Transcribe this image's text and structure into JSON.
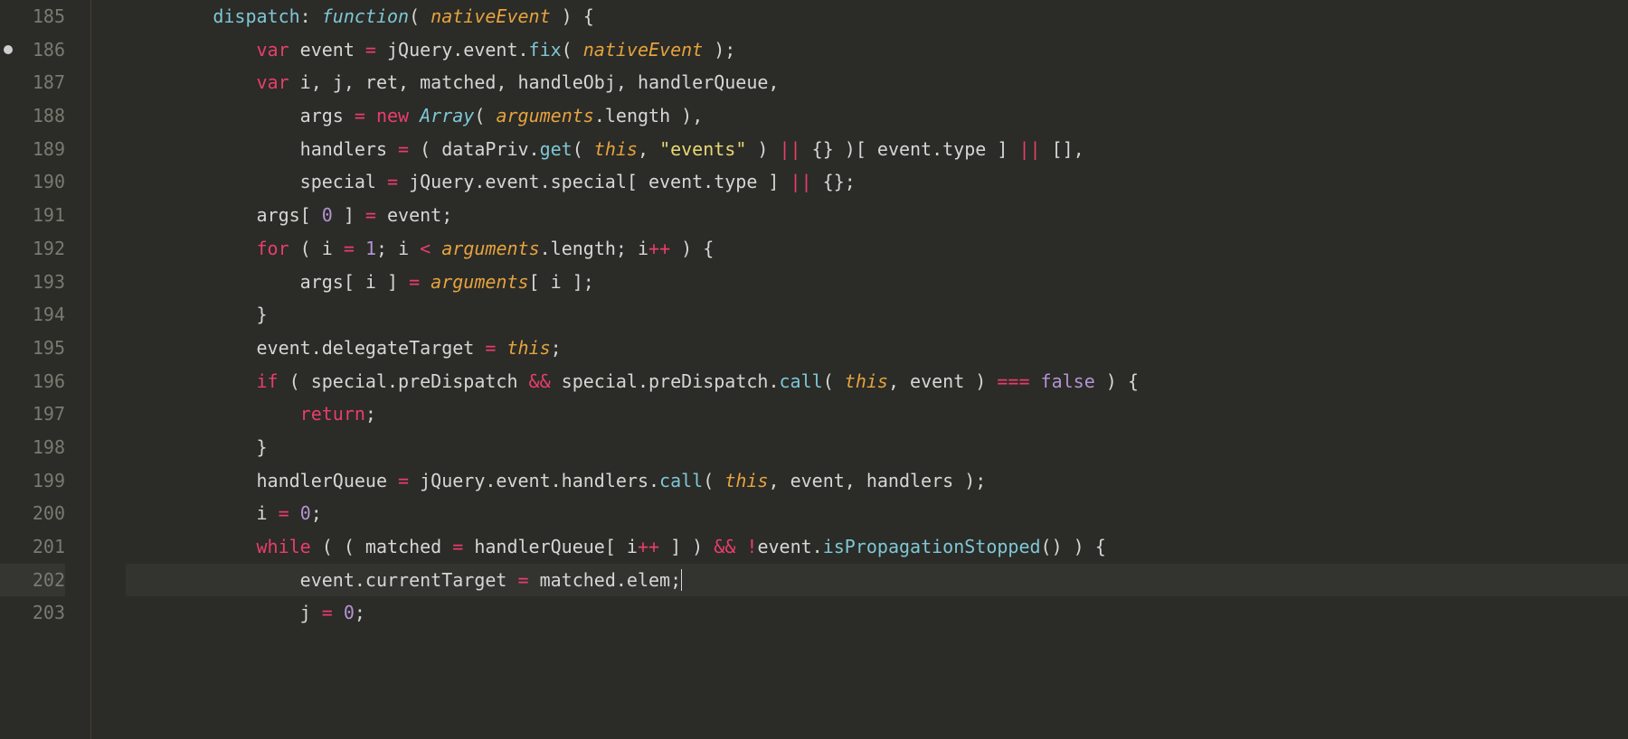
{
  "gutter": {
    "start": 185,
    "end": 203,
    "modified": [
      186
    ],
    "current": 202
  },
  "code": {
    "lines": [
      {
        "n": 185,
        "indent": 2,
        "tokens": [
          [
            "name",
            "dispatch"
          ],
          [
            "punct",
            ": "
          ],
          [
            "func",
            "function"
          ],
          [
            "punct",
            "( "
          ],
          [
            "this",
            "nativeEvent"
          ],
          [
            "punct",
            " ) {"
          ]
        ]
      },
      {
        "n": 186,
        "indent": 3,
        "tokens": [
          [
            "key",
            "var"
          ],
          [
            "ident",
            " event "
          ],
          [
            "op",
            "="
          ],
          [
            "ident",
            " jQuery.event."
          ],
          [
            "call",
            "fix"
          ],
          [
            "punct",
            "( "
          ],
          [
            "this",
            "nativeEvent"
          ],
          [
            "punct",
            " );"
          ]
        ]
      },
      {
        "n": 187,
        "indent": 3,
        "tokens": [
          [
            "key",
            "var"
          ],
          [
            "ident",
            " i, j, ret, matched, handleObj, handlerQueue,"
          ]
        ]
      },
      {
        "n": 188,
        "indent": 4,
        "tokens": [
          [
            "ident",
            "args "
          ],
          [
            "op",
            "="
          ],
          [
            "ident",
            " "
          ],
          [
            "key",
            "new"
          ],
          [
            "ident",
            " "
          ],
          [
            "func",
            "Array"
          ],
          [
            "punct",
            "( "
          ],
          [
            "this",
            "arguments"
          ],
          [
            "punct",
            ".length ),"
          ]
        ]
      },
      {
        "n": 189,
        "indent": 4,
        "tokens": [
          [
            "ident",
            "handlers "
          ],
          [
            "op",
            "="
          ],
          [
            "punct",
            " ( dataPriv."
          ],
          [
            "call",
            "get"
          ],
          [
            "punct",
            "( "
          ],
          [
            "this",
            "this"
          ],
          [
            "punct",
            ", "
          ],
          [
            "str",
            "\"events\""
          ],
          [
            "punct",
            " ) "
          ],
          [
            "op",
            "||"
          ],
          [
            "punct",
            " {} )[ event.type ] "
          ],
          [
            "op",
            "||"
          ],
          [
            "punct",
            " [],"
          ]
        ]
      },
      {
        "n": 190,
        "indent": 4,
        "tokens": [
          [
            "ident",
            "special "
          ],
          [
            "op",
            "="
          ],
          [
            "ident",
            " jQuery.event.special[ event.type ] "
          ],
          [
            "op",
            "||"
          ],
          [
            "punct",
            " {};"
          ]
        ]
      },
      {
        "n": 191,
        "indent": 3,
        "tokens": [
          [
            "ident",
            "args[ "
          ],
          [
            "num",
            "0"
          ],
          [
            "ident",
            " ] "
          ],
          [
            "op",
            "="
          ],
          [
            "ident",
            " event;"
          ]
        ]
      },
      {
        "n": 192,
        "indent": 3,
        "tokens": [
          [
            "key",
            "for"
          ],
          [
            "punct",
            " ( i "
          ],
          [
            "op",
            "="
          ],
          [
            "punct",
            " "
          ],
          [
            "num",
            "1"
          ],
          [
            "punct",
            "; i "
          ],
          [
            "op",
            "<"
          ],
          [
            "punct",
            " "
          ],
          [
            "this",
            "arguments"
          ],
          [
            "punct",
            ".length; i"
          ],
          [
            "op",
            "++"
          ],
          [
            "punct",
            " ) {"
          ]
        ]
      },
      {
        "n": 193,
        "indent": 4,
        "tokens": [
          [
            "ident",
            "args[ i ] "
          ],
          [
            "op",
            "="
          ],
          [
            "ident",
            " "
          ],
          [
            "this",
            "arguments"
          ],
          [
            "ident",
            "[ i ];"
          ]
        ]
      },
      {
        "n": 194,
        "indent": 3,
        "tokens": [
          [
            "punct",
            "}"
          ]
        ]
      },
      {
        "n": 195,
        "indent": 3,
        "tokens": [
          [
            "ident",
            "event.delegateTarget "
          ],
          [
            "op",
            "="
          ],
          [
            "ident",
            " "
          ],
          [
            "this",
            "this"
          ],
          [
            "punct",
            ";"
          ]
        ]
      },
      {
        "n": 196,
        "indent": 3,
        "tokens": [
          [
            "key",
            "if"
          ],
          [
            "punct",
            " ( special.preDispatch "
          ],
          [
            "op",
            "&&"
          ],
          [
            "punct",
            " special.preDispatch."
          ],
          [
            "call",
            "call"
          ],
          [
            "punct",
            "( "
          ],
          [
            "this",
            "this"
          ],
          [
            "punct",
            ", event ) "
          ],
          [
            "op",
            "==="
          ],
          [
            "punct",
            " "
          ],
          [
            "false",
            "false"
          ],
          [
            "punct",
            " ) {"
          ]
        ]
      },
      {
        "n": 197,
        "indent": 4,
        "tokens": [
          [
            "key",
            "return"
          ],
          [
            "punct",
            ";"
          ]
        ]
      },
      {
        "n": 198,
        "indent": 3,
        "tokens": [
          [
            "punct",
            "}"
          ]
        ]
      },
      {
        "n": 199,
        "indent": 3,
        "tokens": [
          [
            "ident",
            "handlerQueue "
          ],
          [
            "op",
            "="
          ],
          [
            "ident",
            " jQuery.event.handlers."
          ],
          [
            "call",
            "call"
          ],
          [
            "punct",
            "( "
          ],
          [
            "this",
            "this"
          ],
          [
            "punct",
            ", event, handlers );"
          ]
        ]
      },
      {
        "n": 200,
        "indent": 3,
        "tokens": [
          [
            "ident",
            "i "
          ],
          [
            "op",
            "="
          ],
          [
            "ident",
            " "
          ],
          [
            "num",
            "0"
          ],
          [
            "punct",
            ";"
          ]
        ]
      },
      {
        "n": 201,
        "indent": 3,
        "tokens": [
          [
            "key",
            "while"
          ],
          [
            "punct",
            " ( ( matched "
          ],
          [
            "op",
            "="
          ],
          [
            "punct",
            " handlerQueue[ i"
          ],
          [
            "op",
            "++"
          ],
          [
            "punct",
            " ] ) "
          ],
          [
            "op",
            "&&"
          ],
          [
            "punct",
            " "
          ],
          [
            "op",
            "!"
          ],
          [
            "punct",
            "event."
          ],
          [
            "call",
            "isPropagationStopped"
          ],
          [
            "punct",
            "() ) {"
          ]
        ]
      },
      {
        "n": 202,
        "indent": 4,
        "current": true,
        "tokens": [
          [
            "ident",
            "event.currentTarget "
          ],
          [
            "op",
            "="
          ],
          [
            "ident",
            " matched.elem;"
          ],
          [
            "cursor",
            ""
          ]
        ]
      },
      {
        "n": 203,
        "indent": 4,
        "tokens": [
          [
            "ident",
            "j "
          ],
          [
            "op",
            "="
          ],
          [
            "ident",
            " "
          ],
          [
            "num",
            "0"
          ],
          [
            "punct",
            ";"
          ]
        ]
      }
    ]
  }
}
